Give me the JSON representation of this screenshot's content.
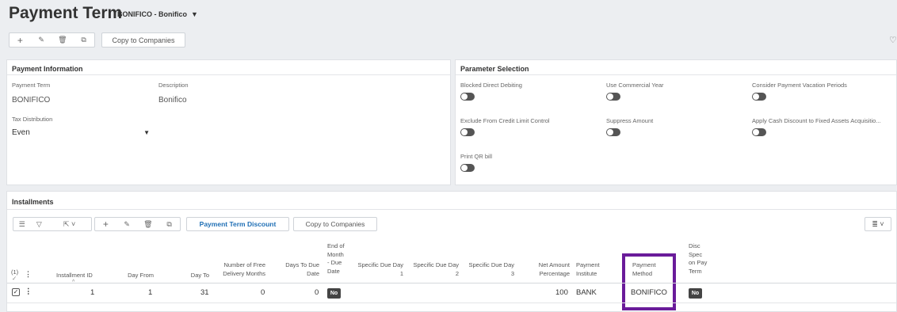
{
  "header": {
    "title": "Payment Term",
    "subtitle": "BONIFICO - Bonifico",
    "toolbar": {
      "copy_label": "Copy to Companies"
    }
  },
  "payment_info": {
    "title": "Payment Information",
    "payment_term_label": "Payment Term",
    "payment_term_value": "BONIFICO",
    "description_label": "Description",
    "description_value": "Bonifico",
    "tax_distribution_label": "Tax Distribution",
    "tax_distribution_value": "Even"
  },
  "parameters": {
    "title": "Parameter Selection",
    "items": [
      {
        "label": "Blocked Direct Debiting",
        "on": false
      },
      {
        "label": "Use Commercial Year",
        "on": false
      },
      {
        "label": "Consider Payment Vacation Periods",
        "on": false
      },
      {
        "label": "Exclude From Credit Limit Control",
        "on": false
      },
      {
        "label": "Suppress Amount",
        "on": false
      },
      {
        "label": "Apply Cash Discount to Fixed Assets Acquisitio...",
        "on": false
      },
      {
        "label": "Print QR bill",
        "on": false
      }
    ]
  },
  "installments": {
    "title": "Installments",
    "discount_button": "Payment Term Discount",
    "copy_button": "Copy to Companies",
    "selection_count": "(1)",
    "columns": {
      "installment_id": "Installment ID",
      "day_from": "Day From",
      "day_to": "Day To",
      "free_months_1": "Number of Free",
      "free_months_2": "Delivery Months",
      "days_due_1": "Days To Due",
      "days_due_2": "Date",
      "eom_1": "End of",
      "eom_2": "Month",
      "eom_3": "- Due",
      "eom_4": "Date",
      "sdd1_1": "Specific Due Day",
      "sdd1_2": "1",
      "sdd2_1": "Specific Due Day",
      "sdd2_2": "2",
      "sdd3_1": "Specific Due Day",
      "sdd3_2": "3",
      "net_1": "Net Amount",
      "net_2": "Percentage",
      "inst_1": "Payment",
      "inst_2": "Institute",
      "method_1": "Payment",
      "method_2": "Method",
      "disc_1": "Disc",
      "disc_2": "Spec",
      "disc_3": "on Pay",
      "disc_4": "Term"
    },
    "rows": [
      {
        "installment_id": "1",
        "day_from": "1",
        "day_to": "31",
        "free_months": "0",
        "days_to_due": "0",
        "end_of_month": "No",
        "net_percentage": "100",
        "payment_institute": "BANK",
        "payment_method": "BONIFICO",
        "disc_spec": "No"
      }
    ]
  },
  "colors": {
    "highlight": "#6a1b9a",
    "accent": "#1f6fb5"
  }
}
